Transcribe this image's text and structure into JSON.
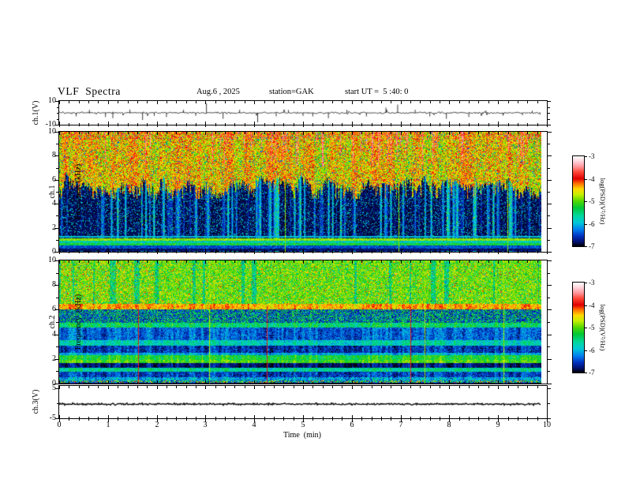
{
  "header": {
    "title": "VLF  Spectra",
    "date": "Aug.6 , 2025",
    "station": "station=GAK",
    "start_ut": "start UT =  5 :40: 0"
  },
  "xaxis": {
    "label": "Time  (min)",
    "ticks": [
      "0",
      "1",
      "2",
      "3",
      "4",
      "5",
      "6",
      "7",
      "8",
      "9",
      "10"
    ],
    "min": 0,
    "max": 10
  },
  "panels": {
    "ch1v": {
      "ylabel": "ch.1(V)",
      "ytop": "10",
      "ybottom": "-10"
    },
    "spec1": {
      "ylabel_line1": "ch.1",
      "ylabel_line2": "Frequency  (kHz)",
      "yticks": [
        "10",
        "8",
        "6",
        "4",
        "2",
        "0"
      ]
    },
    "spec2": {
      "ylabel_line1": "ch.2",
      "ylabel_line2": "Frequency  (kHz)",
      "yticks": [
        "10",
        "8",
        "6",
        "4",
        "2",
        "0"
      ]
    },
    "ch3v": {
      "ylabel": "ch.3(V)",
      "ytop": "5",
      "ybottom": "-5"
    }
  },
  "colorbar": {
    "label": "log(PSD)(V²/Hz)",
    "ticks": [
      "-3",
      "-4",
      "-5",
      "-6",
      "-7"
    ],
    "vmax": -3,
    "vmin": -7,
    "stops": [
      [
        -3.0,
        "#ffffff"
      ],
      [
        -3.2,
        "#ffd9e0"
      ],
      [
        -3.45,
        "#ff9aa0"
      ],
      [
        -3.7,
        "#ff4838"
      ],
      [
        -4.0,
        "#e00000"
      ],
      [
        -4.2,
        "#ff6a00"
      ],
      [
        -4.45,
        "#ffd800"
      ],
      [
        -4.7,
        "#c8f000"
      ],
      [
        -5.0,
        "#50d800"
      ],
      [
        -5.3,
        "#00c838"
      ],
      [
        -5.65,
        "#00d8a0"
      ],
      [
        -5.95,
        "#00c8d8"
      ],
      [
        -6.25,
        "#0080f0"
      ],
      [
        -6.55,
        "#0030c0"
      ],
      [
        -6.8,
        "#001070"
      ],
      [
        -7.0,
        "#000000"
      ]
    ]
  },
  "chart_data": [
    {
      "type": "line",
      "name": "ch1-voltage-trace",
      "ylabel": "ch.1(V)",
      "ylim": [
        -10,
        10
      ],
      "xlim": [
        0,
        10
      ],
      "xlabel": "Time (min)",
      "baseline_sigma_v": 0.55,
      "spikes_t_v": [
        [
          0.35,
          -3
        ],
        [
          0.62,
          2.5
        ],
        [
          0.95,
          -3.5
        ],
        [
          1.1,
          -4.5
        ],
        [
          1.45,
          2.8
        ],
        [
          1.71,
          -6
        ],
        [
          1.95,
          -2.5
        ],
        [
          2.2,
          -3.5
        ],
        [
          2.55,
          2.6
        ],
        [
          2.8,
          -2.5
        ],
        [
          3.02,
          8
        ],
        [
          3.36,
          -5
        ],
        [
          3.7,
          2.6
        ],
        [
          4.07,
          -8
        ],
        [
          4.45,
          -3
        ],
        [
          4.7,
          2.4
        ],
        [
          5.0,
          -2.6
        ],
        [
          5.2,
          -3
        ],
        [
          5.52,
          -4.5
        ],
        [
          5.9,
          2.6
        ],
        [
          6.3,
          -3
        ],
        [
          6.7,
          4.5
        ],
        [
          6.94,
          7
        ],
        [
          7.3,
          2.6
        ],
        [
          7.6,
          -3
        ],
        [
          7.94,
          -5
        ],
        [
          8.4,
          -3.5
        ],
        [
          8.75,
          2
        ],
        [
          9.1,
          -2.4
        ],
        [
          9.5,
          -2
        ],
        [
          9.7,
          1.8
        ]
      ],
      "description": "broadband noise trace with impulsive spikes"
    },
    {
      "type": "heatmap",
      "name": "ch1-spectrogram",
      "ylabel": "Frequency (kHz)",
      "ylim": [
        0,
        10
      ],
      "xlim": [
        0,
        10
      ],
      "value_scale": "log(PSD)(V²/Hz)",
      "vmin": -7,
      "vmax": -3,
      "structure": {
        "green_field_boundary_khz": [
          4.8,
          6.4
        ],
        "red_streaks_above_khz": 7,
        "dark_background_v": -6.85,
        "bands": [
          {
            "f": [
              1.18,
              1.34
            ],
            "v": -5.95,
            "noise": 0.25
          },
          {
            "f": [
              0.92,
              1.1
            ],
            "v": -4.85,
            "noise": 0.2
          },
          {
            "f": [
              0.7,
              0.92
            ],
            "v": -5.75,
            "noise": 0.35
          },
          {
            "f": [
              0.5,
              0.7
            ],
            "v": -5.3,
            "noise": 0.3
          },
          {
            "f": [
              0.28,
              0.5
            ],
            "v": -6.45,
            "noise": 0.25
          },
          {
            "f": [
              0.04,
              0.28
            ],
            "v": -6.8,
            "noise": 0.15
          }
        ]
      }
    },
    {
      "type": "heatmap",
      "name": "ch2-spectrogram",
      "ylabel": "Frequency (kHz)",
      "ylim": [
        0,
        10
      ],
      "xlim": [
        0,
        10
      ],
      "value_scale": "log(PSD)(V²/Hz)",
      "vmin": -7,
      "vmax": -3,
      "structure": {
        "red_lines_min": [
          1.62,
          4.25,
          7.2
        ],
        "bands": [
          {
            "f": [
              6.45,
              10
            ],
            "v": -4.95,
            "noise": 0.45,
            "kind": "field"
          },
          {
            "f": [
              6.02,
              6.45
            ],
            "v": -4.35,
            "noise": 0.3
          },
          {
            "f": [
              4.95,
              6.02
            ],
            "v": -6.55,
            "noise": 0.2,
            "kind": "dash"
          },
          {
            "f": [
              4.55,
              4.95
            ],
            "v": -5.45,
            "noise": 0.35
          },
          {
            "f": [
              3.5,
              4.55
            ],
            "v": -6.35,
            "noise": 0.3
          },
          {
            "f": [
              3.05,
              3.5
            ],
            "v": -5.75,
            "noise": 0.3
          },
          {
            "f": [
              2.5,
              3.05
            ],
            "v": -6.55,
            "noise": 0.3
          },
          {
            "f": [
              2.28,
              2.5
            ],
            "v": -6.05,
            "noise": 0.3
          },
          {
            "f": [
              1.95,
              2.28
            ],
            "v": -5.25,
            "noise": 0.3
          },
          {
            "f": [
              1.68,
              1.95
            ],
            "v": -5.05,
            "noise": 0.3
          },
          {
            "f": [
              1.28,
              1.68
            ],
            "v": -6.75,
            "noise": 0.2
          },
          {
            "f": [
              0.98,
              1.28
            ],
            "v": -5.6,
            "noise": 0.3
          },
          {
            "f": [
              0.52,
              0.98
            ],
            "v": -6.5,
            "noise": 0.3
          },
          {
            "f": [
              0.28,
              0.52
            ],
            "v": -6.05,
            "noise": 0.4
          },
          {
            "f": [
              0.06,
              0.28
            ],
            "v": -5.4,
            "noise": 0.8,
            "kind": "multi"
          },
          {
            "f": [
              0.0,
              0.06
            ],
            "v": -6.85,
            "noise": 0.1
          }
        ]
      }
    },
    {
      "type": "line",
      "name": "ch3-voltage-trace",
      "ylabel": "ch.3(V)",
      "ylim": [
        -5,
        5
      ],
      "xlim": [
        0,
        10
      ],
      "value_v": -0.3,
      "description": "nearly flat trace at about -0.3 V"
    }
  ]
}
